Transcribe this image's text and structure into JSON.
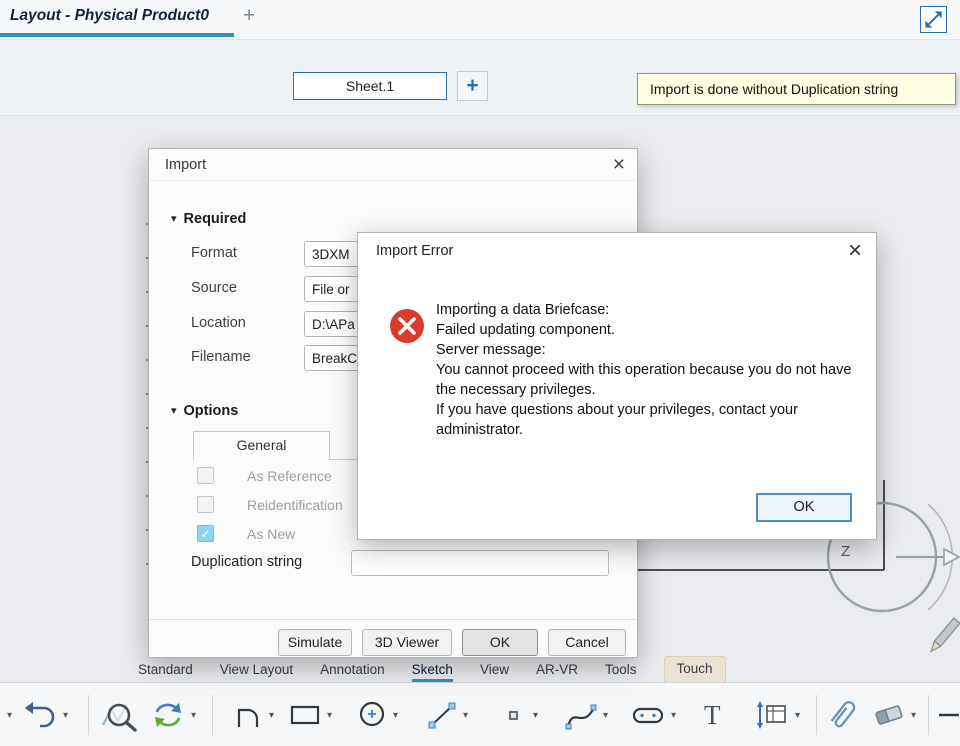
{
  "glyphs": {
    "chevron": "▾",
    "section_arrow": "▾",
    "plus": "+",
    "close": "×",
    "check": "✓",
    "text_tool": "T"
  },
  "colors": {
    "accent": "#2a6fa8",
    "tab_underline": "#2f93be",
    "tooltip_bg": "#ffffe1",
    "error_red": "#d83b2c",
    "check_blue": "#8fd4ef"
  },
  "header": {
    "document_tab": "Layout - Physical Product0",
    "new_tab": "+"
  },
  "sheet_bar": {
    "sheet": "Sheet.1",
    "add_sheet": "+",
    "notification": "Import is done without Duplication string"
  },
  "import_dialog": {
    "title": "Import",
    "required_section": "Required",
    "options_section": "Options",
    "fields": [
      {
        "label": "Format",
        "value": "3DXM"
      },
      {
        "label": "Source",
        "value": "File or"
      },
      {
        "label": "Location",
        "value": "D:\\APa"
      },
      {
        "label": "Filename",
        "value": "BreakC"
      }
    ],
    "general_tab": "General",
    "checkboxes": [
      {
        "label": "As Reference",
        "checked": false
      },
      {
        "label": "Reidentification",
        "checked": false
      },
      {
        "label": "As New",
        "checked": true
      }
    ],
    "duplication_label": "Duplication string",
    "duplication_value": "",
    "buttons": {
      "simulate": "Simulate",
      "viewer": "3D Viewer",
      "ok": "OK",
      "cancel": "Cancel"
    }
  },
  "error_dialog": {
    "title": "Import Error",
    "lines": [
      "Importing a data Briefcase:",
      "Failed updating component.",
      "Server message:",
      "You cannot proceed with this operation because you do not have the necessary privileges.",
      "If you have questions about your privileges, contact your administrator."
    ],
    "ok": "OK"
  },
  "ribbon": {
    "tabs": [
      "Standard",
      "View Layout",
      "Annotation",
      "Sketch",
      "View",
      "AR-VR",
      "Tools",
      "Touch"
    ],
    "active": "Sketch"
  },
  "compass": {
    "axis": "Z"
  },
  "toolbar": {
    "tools": [
      "undo",
      "zoom-preview",
      "update",
      "profile",
      "rectangle",
      "circle",
      "line",
      "point",
      "spline",
      "slot",
      "text",
      "dimension",
      "attach",
      "eraser",
      "line-segment"
    ]
  }
}
